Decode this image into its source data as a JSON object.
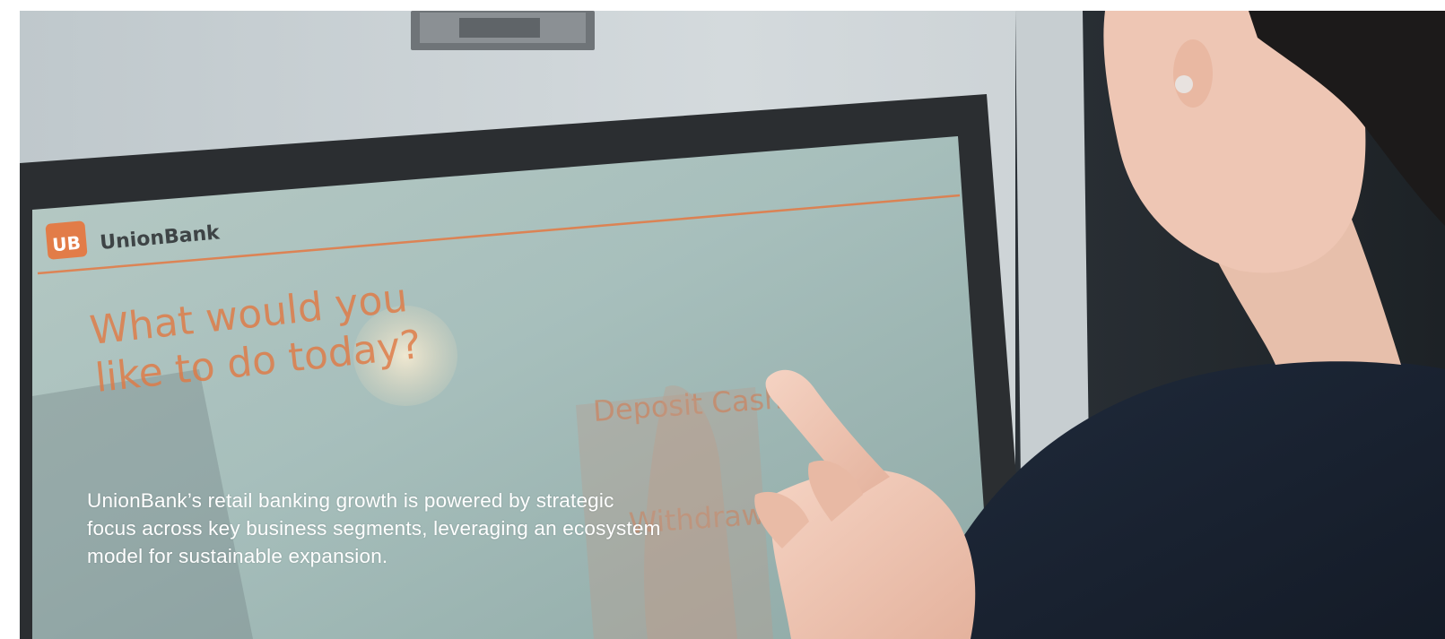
{
  "photo": {
    "kiosk_screen": {
      "logo_mark": "UB",
      "logo_text": "UnionBank",
      "heading_line1": "What would you",
      "heading_line2": "like to do today?",
      "option_1": "Deposit Cash",
      "option_2": "Withdraw"
    }
  },
  "caption": {
    "line1": "UnionBank’s retail banking growth is powered by strategic",
    "line2": "focus across key business segments, leveraging an ecosystem",
    "line3": "model for sustainable expansion."
  },
  "colors": {
    "brand_orange": "#e8743b",
    "caption_text": "#ffffff",
    "kiosk_frame": "#c9d0d3",
    "bezel": "#2a2d30",
    "screen": "#a9c0bc",
    "shirt": "#1b2433",
    "skin": "#f0c9b8"
  }
}
